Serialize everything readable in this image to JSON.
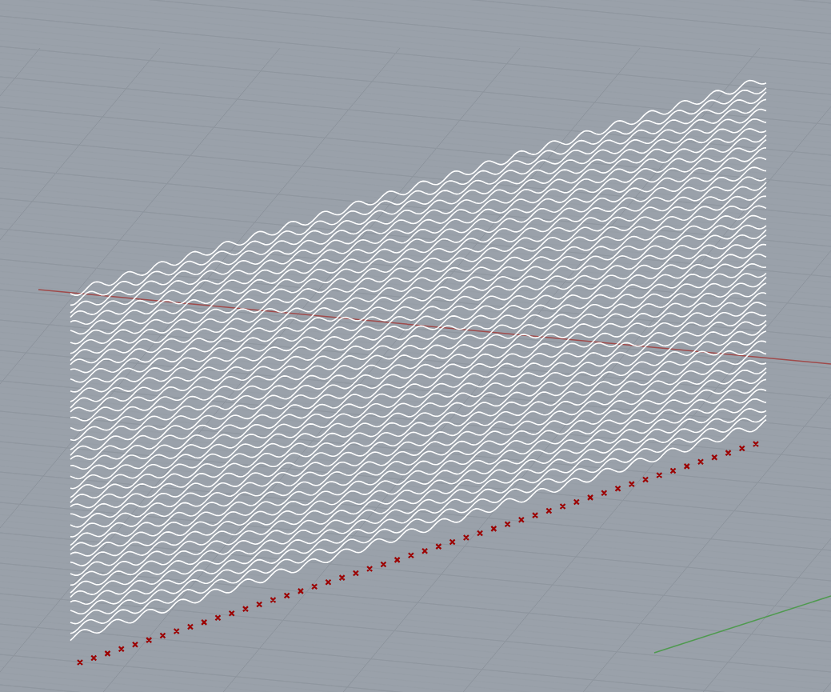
{
  "viewport": {
    "grid": true,
    "axes": true,
    "curves": true,
    "points": true
  }
}
